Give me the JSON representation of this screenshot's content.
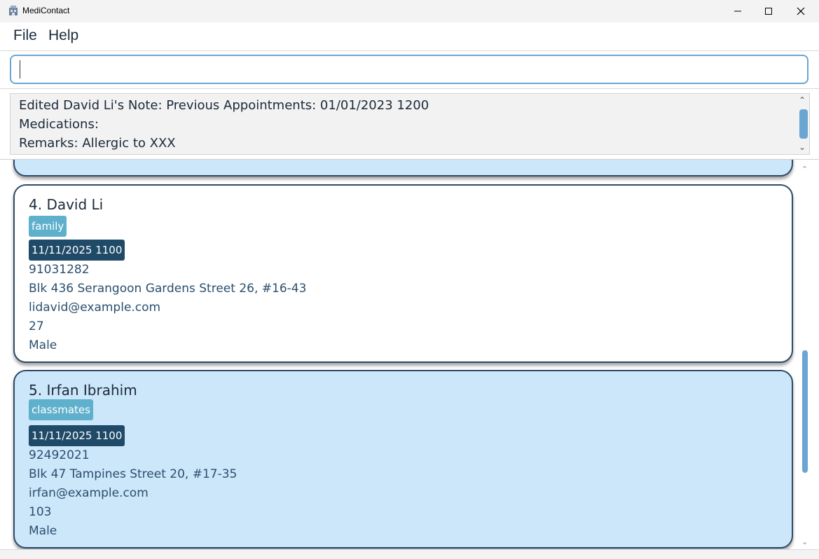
{
  "window": {
    "title": "MediContact",
    "icon": "app-icon",
    "controls": [
      "minimize-icon",
      "maximize-icon",
      "close-icon"
    ]
  },
  "menu": {
    "file_label": "File",
    "help_label": "Help"
  },
  "command": {
    "value": "",
    "placeholder": ""
  },
  "result": {
    "lines": [
      "Edited David Li's Note: Previous Appointments: 01/01/2023 1200",
      "Medications:",
      "Remarks: Allergic to XXX"
    ]
  },
  "persons": [
    {
      "index_name": "4. David Li",
      "tag": "family",
      "appointment": "11/11/2025 1100",
      "phone": "91031282",
      "address": "Blk 436 Serangoon Gardens Street 26, #16-43",
      "email": "lidavid@example.com",
      "age": "27",
      "sex": "Male"
    },
    {
      "index_name": "5. Irfan Ibrahim",
      "tag": "classmates",
      "appointment": "11/11/2025 1100",
      "phone": "92492021",
      "address": "Blk 47 Tampines Street 20, #17-35",
      "email": "irfan@example.com",
      "age": "103",
      "sex": "Male"
    }
  ],
  "colors": {
    "selected_card": "#cce6fa",
    "card_border": "#2c4a66",
    "tag": "#5fb0cc",
    "appointment": "#1f4a68",
    "scroll_thumb": "#69a7d2",
    "input_border": "#6aa6cf"
  }
}
